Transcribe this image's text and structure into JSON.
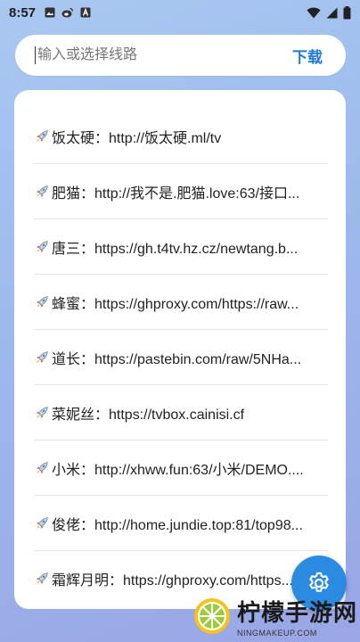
{
  "status_bar": {
    "time": "8:57",
    "left_icons": [
      "image-icon",
      "weibo-icon",
      "a-box-icon"
    ],
    "right_icons": [
      "wifi-icon",
      "signal-icon",
      "battery-icon"
    ]
  },
  "search": {
    "placeholder": "输入或选择线路",
    "value": "",
    "download_label": "下载"
  },
  "routes": [
    {
      "icon": "rocket-icon",
      "text": "饭太硬：http://饭太硬.ml/tv"
    },
    {
      "icon": "rocket-icon",
      "text": "肥猫：http://我不是.肥猫.love:63/接口..."
    },
    {
      "icon": "rocket-icon",
      "text": "唐三：https://gh.t4tv.hz.cz/newtang.b..."
    },
    {
      "icon": "rocket-icon",
      "text": "蜂蜜：https://ghproxy.com/https://raw..."
    },
    {
      "icon": "rocket-icon",
      "text": "道长：https://pastebin.com/raw/5NHa..."
    },
    {
      "icon": "rocket-icon",
      "text": "菜妮丝：https://tvbox.cainisi.cf"
    },
    {
      "icon": "rocket-icon",
      "text": "小米：http://xhww.fun:63/小米/DEMO...."
    },
    {
      "icon": "rocket-icon",
      "text": "俊佬：http://home.jundie.top:81/top98..."
    },
    {
      "icon": "rocket-icon",
      "text": "霜辉月明：https://ghproxy.com/https..."
    }
  ],
  "fab": {
    "icon": "gear-icon",
    "color": "#2b8be0"
  },
  "watermark": {
    "title": "柠檬手游网",
    "subtitle": "NINGMAKEUP.COM"
  },
  "colors": {
    "accent": "#1e7ad8",
    "fab": "#2b8be0"
  }
}
